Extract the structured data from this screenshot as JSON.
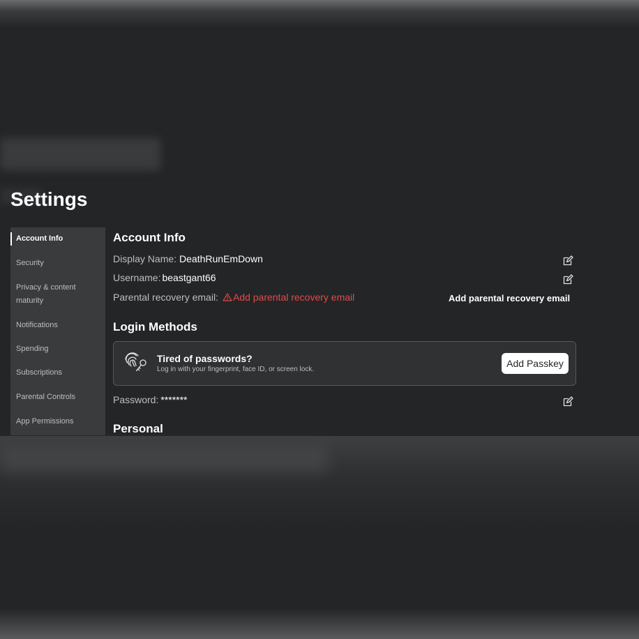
{
  "page": {
    "title": "Settings"
  },
  "sidebar": {
    "items": [
      {
        "label": "Account Info",
        "active": true
      },
      {
        "label": "Security"
      },
      {
        "label": "Privacy & content",
        "label2": "maturity"
      },
      {
        "label": "Notifications"
      },
      {
        "label": "Spending"
      },
      {
        "label": "Subscriptions"
      },
      {
        "label": "Parental Controls"
      },
      {
        "label": "App Permissions"
      }
    ]
  },
  "account_info": {
    "heading": "Account Info",
    "display_name_label": "Display Name:",
    "display_name_value": "DeathRunEmDown",
    "username_label": "Username:",
    "username_value": "beastgant66",
    "parental_label": "Parental recovery email:",
    "parental_warning": "Add parental recovery email",
    "parental_action": "Add parental recovery email"
  },
  "login_methods": {
    "heading": "Login Methods",
    "card_title": "Tired of passwords?",
    "card_subtitle": "Log in with your fingerprint, face ID, or screen lock.",
    "card_button": "Add Passkey",
    "password_label": "Password:",
    "password_value": "*******"
  },
  "personal": {
    "heading": "Personal"
  },
  "colors": {
    "background": "#232527",
    "sidebar": "#393b3d",
    "warning": "#e8484a",
    "text": "#ffffff",
    "muted": "#bdbec0"
  },
  "icons": [
    "edit-icon",
    "warning-icon",
    "fingerprint-icon"
  ]
}
